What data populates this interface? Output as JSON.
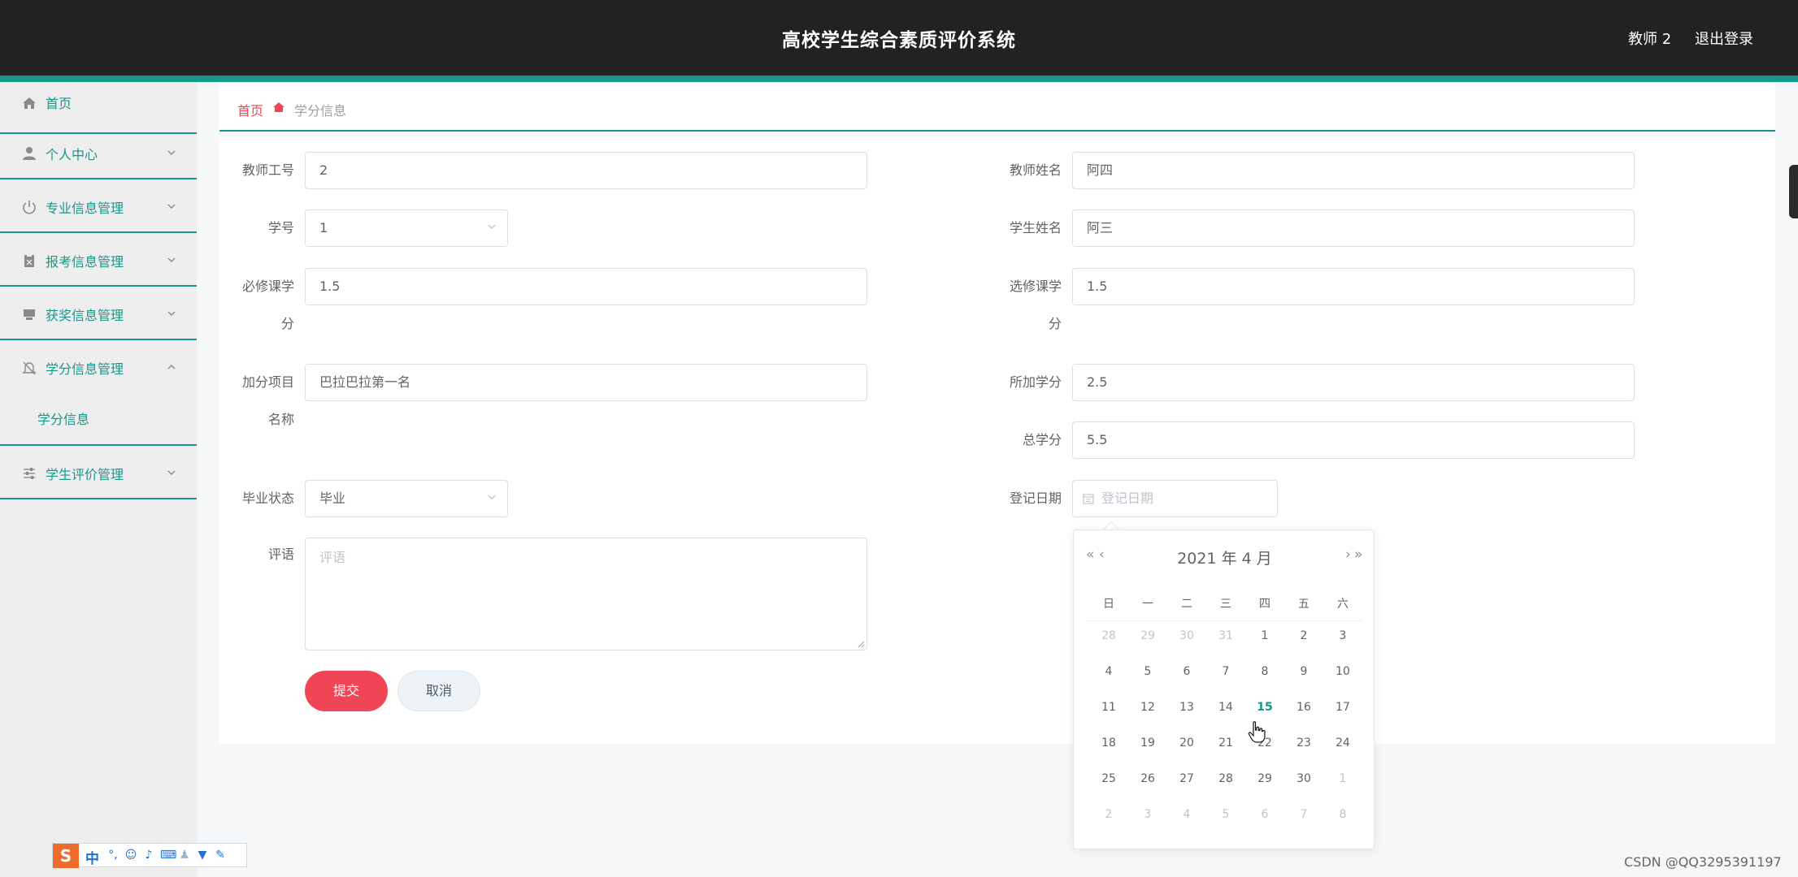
{
  "header": {
    "title": "高校学生综合素质评价系统",
    "user": "教师 2",
    "logout": "退出登录"
  },
  "sidebar": {
    "items": [
      {
        "label": "首页",
        "icon": "home-icon"
      },
      {
        "label": "个人中心",
        "icon": "user-icon"
      },
      {
        "label": "专业信息管理",
        "icon": "power-icon"
      },
      {
        "label": "报考信息管理",
        "icon": "clipboard-icon"
      },
      {
        "label": "获奖信息管理",
        "icon": "monitor-icon"
      },
      {
        "label": "学分信息管理",
        "icon": "bell-off-icon"
      },
      {
        "label": "学生评价管理",
        "icon": "sliders-icon"
      }
    ],
    "sub_items": {
      "credit": "学分信息"
    }
  },
  "breadcrumb": {
    "home": "首页",
    "current": "学分信息"
  },
  "form": {
    "teacher_id": {
      "label": "教师工号",
      "value": "2"
    },
    "teacher_name": {
      "label": "教师姓名",
      "value": "阿四"
    },
    "student_id": {
      "label": "学号",
      "value": "1"
    },
    "student_name": {
      "label": "学生姓名",
      "value": "阿三"
    },
    "required_credit": {
      "label_line1": "必修课学",
      "label_line2": "分",
      "value": "1.5"
    },
    "elective_credit": {
      "label_line1": "选修课学",
      "label_line2": "分",
      "value": "1.5"
    },
    "bonus_item": {
      "label_line1": "加分项目",
      "label_line2": "名称",
      "value": "巴拉巴拉第一名"
    },
    "bonus_credit": {
      "label": "所加学分",
      "value": "2.5"
    },
    "total_credit": {
      "label": "总学分",
      "value": "5.5"
    },
    "grad_status": {
      "label": "毕业状态",
      "value": "毕业"
    },
    "reg_date": {
      "label": "登记日期",
      "placeholder": "登记日期"
    },
    "comment": {
      "label": "评语",
      "placeholder": "评语"
    },
    "submit": "提交",
    "cancel": "取消"
  },
  "datepicker": {
    "title": "2021 年  4 月",
    "prev_year": "«",
    "prev_month": "‹",
    "next_month": "›",
    "next_year": "»",
    "weekdays": [
      "日",
      "一",
      "二",
      "三",
      "四",
      "五",
      "六"
    ],
    "weeks": [
      [
        "28",
        "29",
        "30",
        "31",
        "1",
        "2",
        "3"
      ],
      [
        "4",
        "5",
        "6",
        "7",
        "8",
        "9",
        "10"
      ],
      [
        "11",
        "12",
        "13",
        "14",
        "15",
        "16",
        "17"
      ],
      [
        "18",
        "19",
        "20",
        "21",
        "22",
        "23",
        "24"
      ],
      [
        "25",
        "26",
        "27",
        "28",
        "29",
        "30",
        "1"
      ],
      [
        "2",
        "3",
        "4",
        "5",
        "6",
        "7",
        "8"
      ]
    ],
    "today": "15"
  },
  "ime": {
    "mode": "中"
  },
  "watermark": "CSDN @QQ3295391197",
  "colors": {
    "accent": "#17978a",
    "primary_button": "#ef4555",
    "header_bg": "#222222"
  }
}
